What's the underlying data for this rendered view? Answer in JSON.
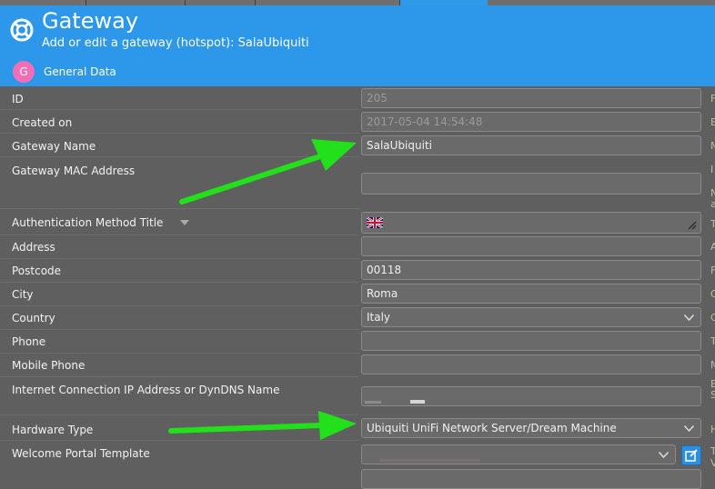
{
  "header": {
    "title": "Gateway",
    "subtitle": "Add or edit a gateway (hotspot): SalaUbiquiti",
    "section_initial": "G",
    "section_title": "General Data"
  },
  "fields": {
    "id": {
      "label": "ID",
      "value": "205"
    },
    "created_on": {
      "label": "Created on",
      "value": "2017-05-04 14:54:48"
    },
    "gateway_name": {
      "label": "Gateway Name",
      "value": "SalaUbiquiti"
    },
    "gateway_mac": {
      "label": "Gateway MAC Address",
      "value": ""
    },
    "auth_method_title": {
      "label": "Authentication Method Title",
      "flag_icon": "uk-flag-icon",
      "value": ""
    },
    "address": {
      "label": "Address",
      "value": ""
    },
    "postcode": {
      "label": "Postcode",
      "value": "00118"
    },
    "city": {
      "label": "City",
      "value": "Roma"
    },
    "country": {
      "label": "Country",
      "value": "Italy"
    },
    "phone": {
      "label": "Phone",
      "value": ""
    },
    "mobile_phone": {
      "label": "Mobile Phone",
      "value": ""
    },
    "internet_ip": {
      "label": "Internet Connection IP Address or DynDNS Name",
      "value": ""
    },
    "hardware_type": {
      "label": "Hardware Type",
      "value": "Ubiquiti UniFi Network Server/Dream Machine"
    },
    "welcome_template": {
      "label": "Welcome Portal Template",
      "value": ""
    }
  },
  "colors": {
    "header_bg": "#2d97ea",
    "page_bg": "#5f5f5f",
    "annotation_arrow": "#22e01a"
  },
  "right_edge_letters": [
    "F",
    "E",
    "M",
    "I",
    "N",
    "a",
    "T",
    "A",
    "F",
    "C",
    "C",
    "T",
    "M",
    "E",
    "S",
    "H",
    "T",
    "V"
  ]
}
